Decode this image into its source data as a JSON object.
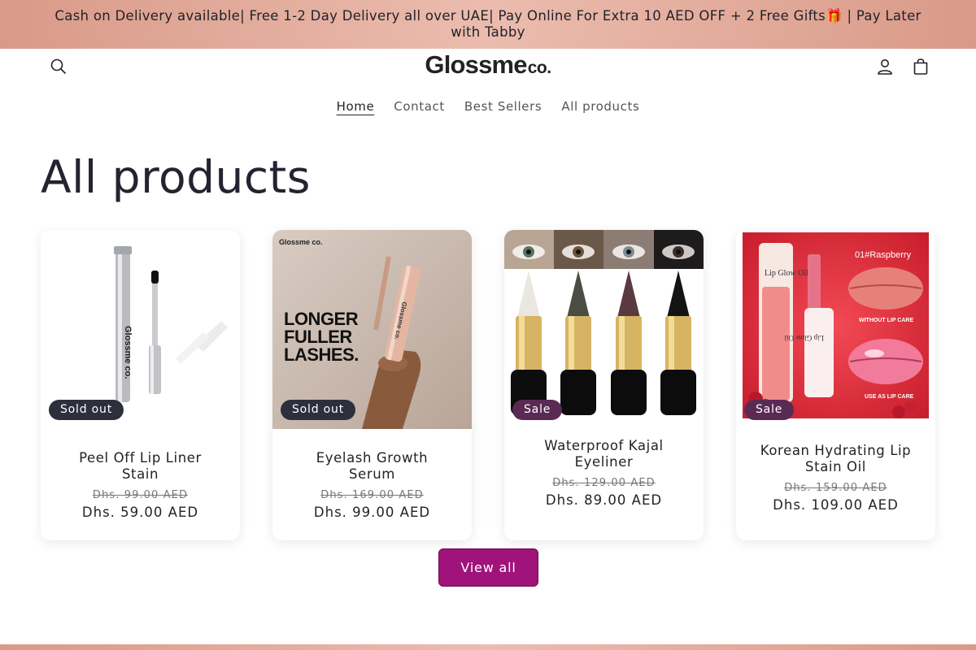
{
  "announcement": "Cash on Delivery available| Free 1-2 Day Delivery all over UAE| Pay Online For Extra 10 AED OFF + 2 Free Gifts🎁 | Pay Later with Tabby",
  "colors": {
    "announcement_bg": "#e4ae9f",
    "button_bg": "#a0137a",
    "sold_out_badge": "#2e2f3d",
    "sale_badge": "#5a2a55"
  },
  "header": {
    "logo_main": "Glossme",
    "logo_sub": "co.",
    "icons": [
      "search-icon",
      "account-icon",
      "cart-icon"
    ]
  },
  "nav": {
    "items": [
      {
        "label": "Home",
        "active": true
      },
      {
        "label": "Contact"
      },
      {
        "label": "Best Sellers"
      },
      {
        "label": "All products"
      }
    ]
  },
  "page_title": "All products",
  "products": [
    {
      "name": "Peel Off Lip Liner Stain",
      "old_price": "Dhs. 99.00 AED",
      "price": "Dhs. 59.00 AED",
      "badge": "Sold out",
      "image": {
        "brand": "Glossme co."
      }
    },
    {
      "name": "Eyelash Growth Serum",
      "old_price": "Dhs. 169.00 AED",
      "price": "Dhs. 99.00 AED",
      "badge": "Sold out",
      "image": {
        "brand": "Glossme co.",
        "line1": "LONGER",
        "line2": "FULLER",
        "line3": "LASHES.",
        "tube_text": "Glossme co."
      }
    },
    {
      "name": "Waterproof Kajal Eyeliner",
      "old_price": "Dhs. 129.00 AED",
      "price": "Dhs. 89.00 AED",
      "badge": "Sale"
    },
    {
      "name": "Korean Hydrating Lip Stain Oil",
      "old_price": "Dhs. 159.00 AED",
      "price": "Dhs. 109.00 AED",
      "badge": "Sale",
      "image": {
        "shade": "01#Raspberry",
        "product_label": "Lip Glow Oil",
        "without": "WITHOUT LIP CARE",
        "with": "USE AS LIP CARE"
      }
    }
  ],
  "view_all_label": "View all"
}
